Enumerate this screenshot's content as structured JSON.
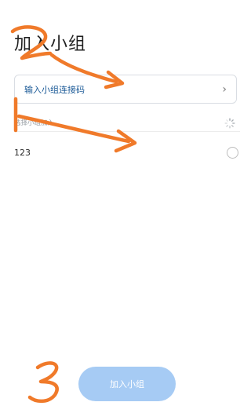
{
  "header": {
    "title": "加入小组"
  },
  "join_code": {
    "label": "输入小组连接码",
    "chevron": "›"
  },
  "group_selection": {
    "section_label": "选择小组加入",
    "loading_icon": "spinner-icon",
    "groups": [
      {
        "name": "123",
        "selected": false
      }
    ]
  },
  "footer": {
    "join_button_label": "加入小组",
    "button_color": "#a6cbf4"
  },
  "annotations": {
    "marks": [
      "2",
      "1",
      "3"
    ],
    "color": "#f07a2a"
  }
}
